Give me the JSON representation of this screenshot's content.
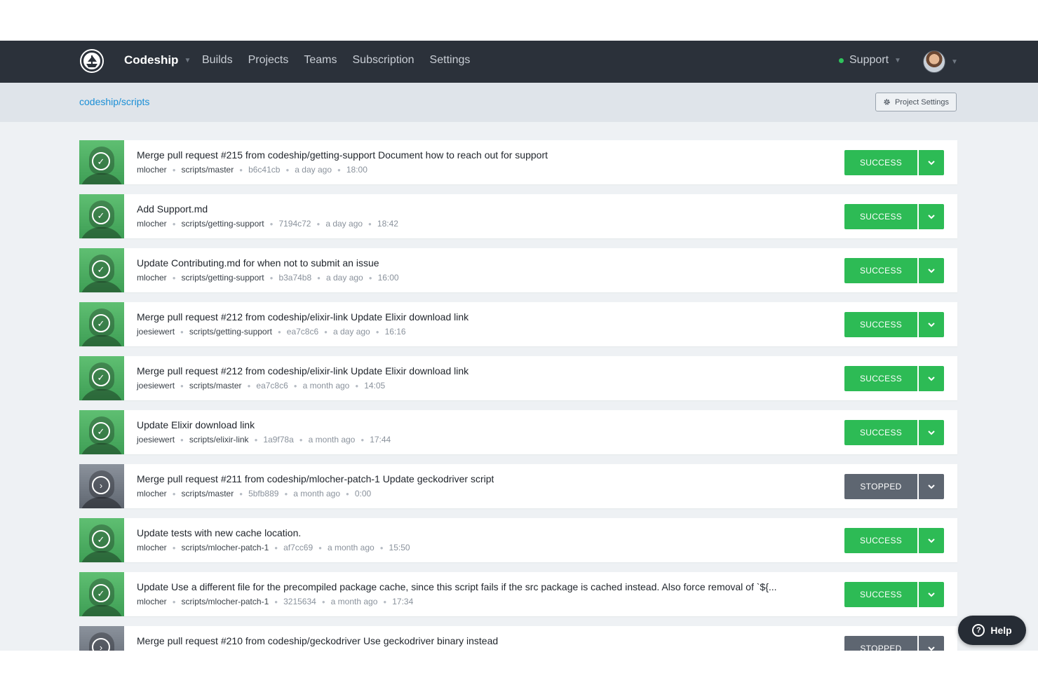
{
  "nav": {
    "brand": "Codeship",
    "links": [
      "Builds",
      "Projects",
      "Teams",
      "Subscription",
      "Settings"
    ],
    "support": "Support"
  },
  "subbar": {
    "breadcrumb": "codeship/scripts",
    "project_settings": "Project Settings"
  },
  "builds": [
    {
      "message": "Merge pull request #215 from codeship/getting-support Document how to reach out for support",
      "author": "mlocher",
      "branch": "scripts/master",
      "commit": "b6c41cb",
      "time": "a day ago",
      "duration": "18:00",
      "status": "SUCCESS"
    },
    {
      "message": "Add Support.md",
      "author": "mlocher",
      "branch": "scripts/getting-support",
      "commit": "7194c72",
      "time": "a day ago",
      "duration": "18:42",
      "status": "SUCCESS"
    },
    {
      "message": "Update Contributing.md for when not to submit an issue",
      "author": "mlocher",
      "branch": "scripts/getting-support",
      "commit": "b3a74b8",
      "time": "a day ago",
      "duration": "16:00",
      "status": "SUCCESS"
    },
    {
      "message": "Merge pull request #212 from codeship/elixir-link Update Elixir download link",
      "author": "joesiewert",
      "branch": "scripts/getting-support",
      "commit": "ea7c8c6",
      "time": "a day ago",
      "duration": "16:16",
      "status": "SUCCESS"
    },
    {
      "message": "Merge pull request #212 from codeship/elixir-link Update Elixir download link",
      "author": "joesiewert",
      "branch": "scripts/master",
      "commit": "ea7c8c6",
      "time": "a month ago",
      "duration": "14:05",
      "status": "SUCCESS"
    },
    {
      "message": "Update Elixir download link",
      "author": "joesiewert",
      "branch": "scripts/elixir-link",
      "commit": "1a9f78a",
      "time": "a month ago",
      "duration": "17:44",
      "status": "SUCCESS"
    },
    {
      "message": "Merge pull request #211 from codeship/mlocher-patch-1 Update geckodriver script",
      "author": "mlocher",
      "branch": "scripts/master",
      "commit": "5bfb889",
      "time": "a month ago",
      "duration": "0:00",
      "status": "STOPPED"
    },
    {
      "message": "Update tests with new cache location.",
      "author": "mlocher",
      "branch": "scripts/mlocher-patch-1",
      "commit": "af7cc69",
      "time": "a month ago",
      "duration": "15:50",
      "status": "SUCCESS"
    },
    {
      "message": "Update Use a different file for the precompiled package cache, since this script fails if the src package is cached instead. Also force removal of `${...",
      "author": "mlocher",
      "branch": "scripts/mlocher-patch-1",
      "commit": "3215634",
      "time": "a month ago",
      "duration": "17:34",
      "status": "SUCCESS"
    },
    {
      "message": "Merge pull request #210 from codeship/geckodriver Use geckodriver binary instead",
      "author": "",
      "branch": "",
      "commit": "",
      "time": "",
      "duration": "",
      "status": "STOPPED"
    }
  ],
  "help": "Help",
  "icons": {
    "success": "check-circle-icon",
    "stopped": "chevron-right-circle-icon",
    "dropdown": "chevron-down-icon",
    "gear": "gear-icon",
    "help": "question-circle-icon"
  },
  "colors": {
    "nav_bg": "#2b313a",
    "success": "#2dbb55",
    "stopped": "#5e6671",
    "link": "#1b8fd6",
    "support_dot": "#2fc35c"
  }
}
